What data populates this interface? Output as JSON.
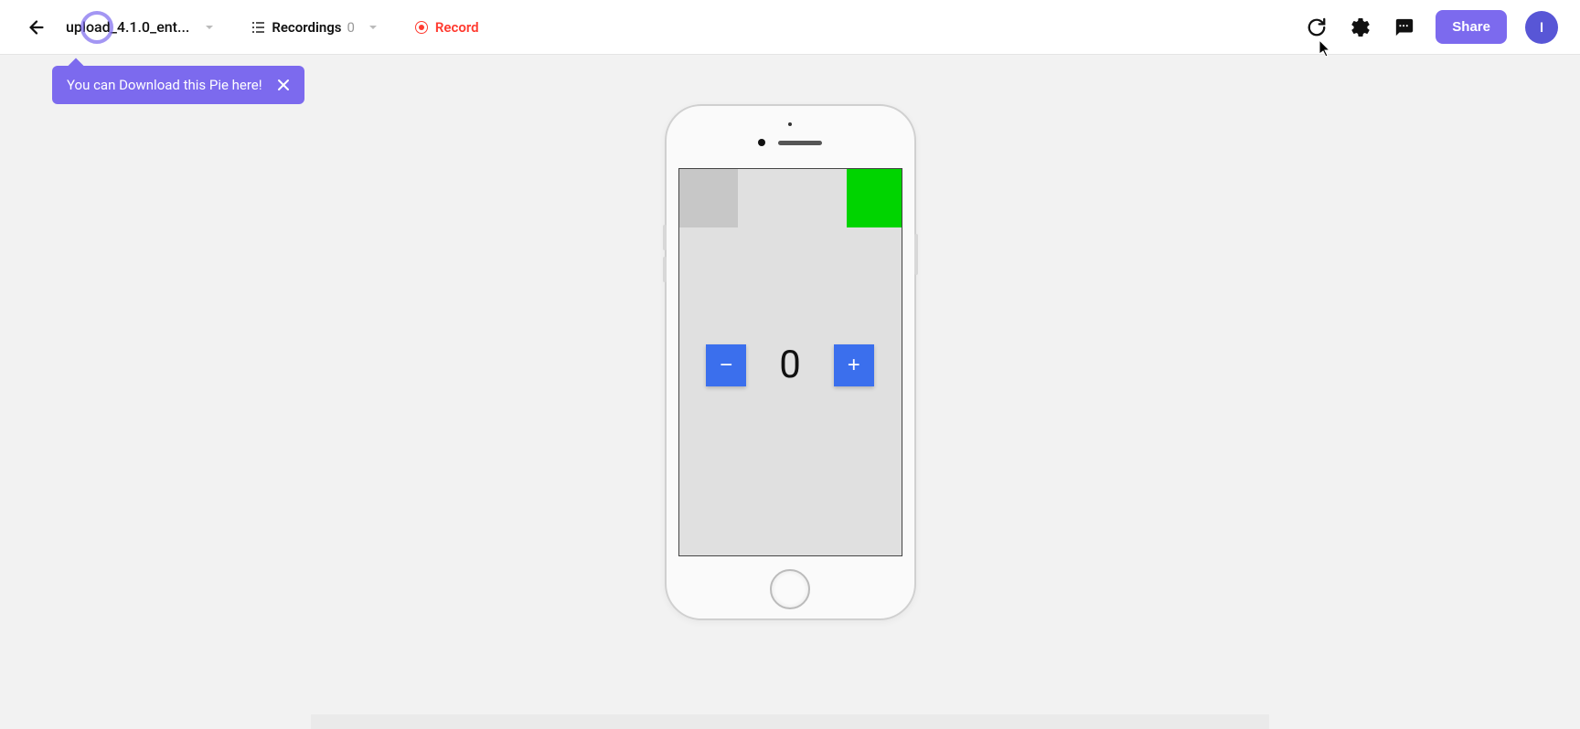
{
  "header": {
    "project_name": "upload_4.1.0_ent...",
    "recordings_label": "Recordings",
    "recordings_count": "0",
    "record_label": "Record",
    "share_label": "Share",
    "avatar_initial": "I"
  },
  "tooltip": {
    "text": "You can Download this Pie here!"
  },
  "app": {
    "counter_value": "0",
    "minus_label": "−",
    "plus_label": "+"
  }
}
